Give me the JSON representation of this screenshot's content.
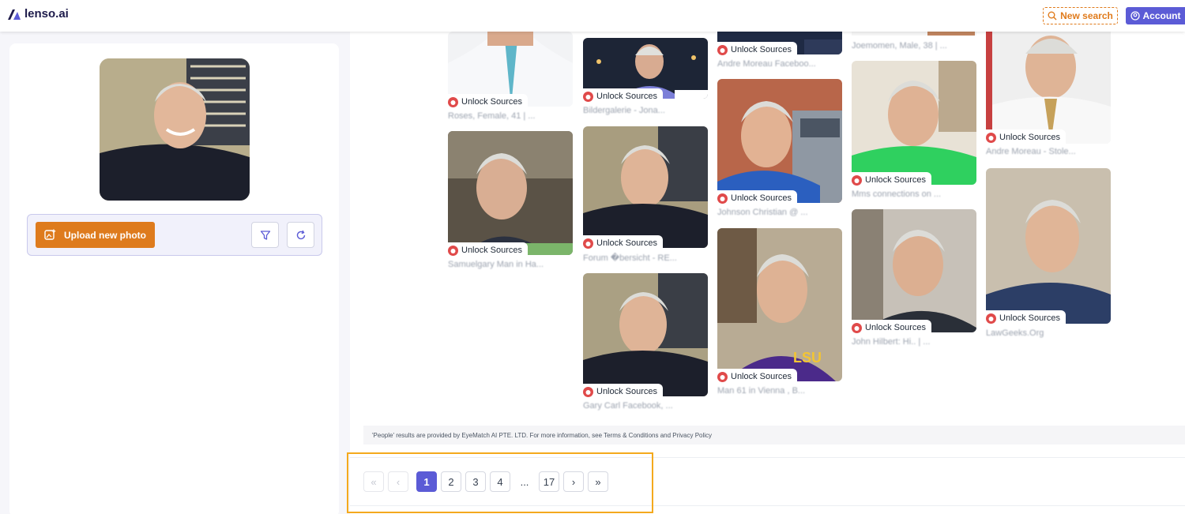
{
  "header": {
    "logo_text": "lenso.ai",
    "new_search_label": "New search",
    "account_label": "Account"
  },
  "toolbar": {
    "upload_label": "Upload new photo"
  },
  "unlock_label": "Unlock Sources",
  "results": [
    {
      "caption": "Roses, Female, 41 | ..."
    },
    {
      "caption": "Samuelgary Man in Ha..."
    },
    {
      "caption": "Bildergalerie - Jona..."
    },
    {
      "caption": "Forum �bersicht - RE..."
    },
    {
      "caption": "Gary Carl Facebook, ..."
    },
    {
      "caption": "Andre Moreau Faceboo..."
    },
    {
      "caption": "Johnson Christian @ ..."
    },
    {
      "caption": "Man 61 in Vienna , B..."
    },
    {
      "caption": "Joemomen, Male, 38 | ..."
    },
    {
      "caption": "Mms connections on ..."
    },
    {
      "caption": "John Hilbert: Hi.. | ..."
    },
    {
      "caption": "Andre Moreau - Stole..."
    },
    {
      "caption": "LawGeeks.Org"
    }
  ],
  "disclaimer": "'People' results are provided by EyeMatch AI PTE. LTD. For more information, see Terms & Conditions and Privacy Policy",
  "pagination": {
    "first": "«",
    "prev": "‹",
    "pages": [
      "1",
      "2",
      "3",
      "4"
    ],
    "ellipsis": "...",
    "last_page": "17",
    "next": "›",
    "last": "»",
    "current": "1"
  },
  "colors": {
    "brand": "#5b5bd6",
    "orange": "#de7b1d",
    "highlight": "#f4a91d",
    "unlock_icon": "#e04a4a"
  }
}
